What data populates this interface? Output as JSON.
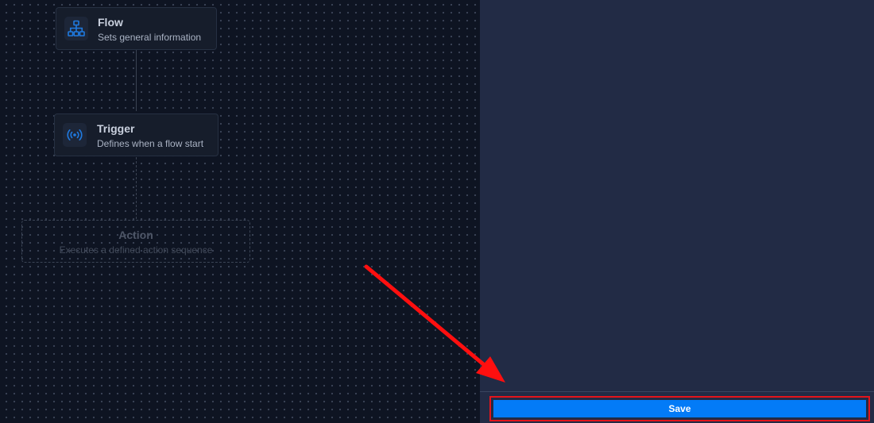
{
  "canvas": {
    "nodes": {
      "flow": {
        "icon": "sitemap-icon",
        "title": "Flow",
        "subtitle": "Sets general information"
      },
      "trigger": {
        "icon": "broadcast-icon",
        "title": "Trigger",
        "subtitle": "Defines when a flow start"
      },
      "action": {
        "title": "Action",
        "subtitle": "Executes a defined action sequence"
      }
    }
  },
  "panel": {
    "save_label": "Save"
  },
  "annotation": {
    "arrow": "red-arrow-icon",
    "highlight_color": "#e3141b"
  },
  "colors": {
    "canvas_bg": "#0e1422",
    "panel_bg": "#222b45",
    "accent": "#037bf7",
    "icon_blue": "#1f7ae0"
  }
}
